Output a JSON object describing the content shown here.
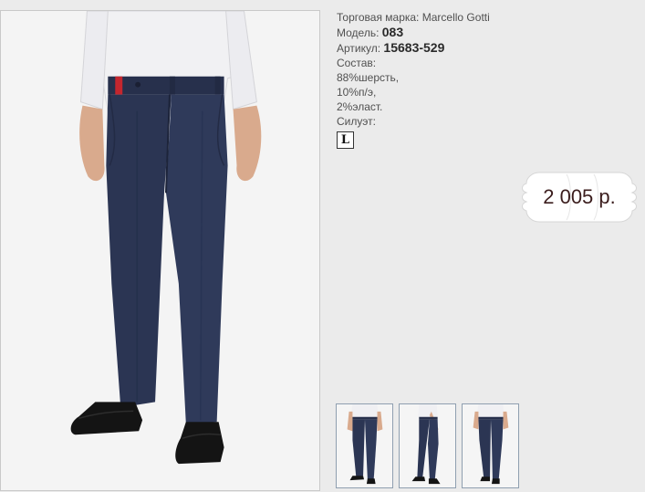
{
  "product": {
    "brand_label": "Торговая марка:",
    "brand_value": "Marcello Gotti",
    "model_label": "Модель:",
    "model_value": "083",
    "article_label": "Артикул:",
    "article_value": "15683-529",
    "composition_label": "Состав:",
    "composition_lines": [
      "88%шерсть,",
      "10%п/э,",
      "2%эласт."
    ],
    "silhouette_label": "Силуэт:",
    "silhouette_value": "L"
  },
  "price": {
    "text": "2 005 р."
  },
  "images": {
    "main": "trousers-photo-front",
    "thumbnails": [
      "trousers-thumb-front",
      "trousers-thumb-side",
      "trousers-thumb-back"
    ]
  },
  "colors": {
    "trousers": "#2b3553",
    "shirt": "#f1f1f3",
    "price_text": "#3b1d1d"
  }
}
